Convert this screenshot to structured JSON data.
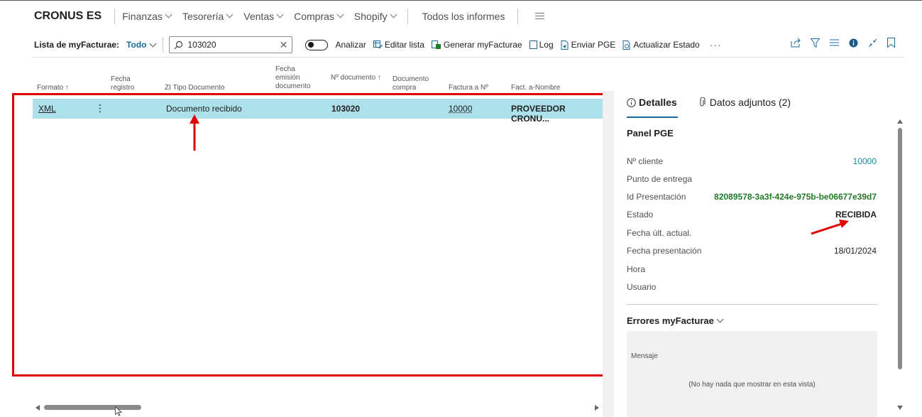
{
  "app": {
    "brand": "CRONUS ES",
    "nav": [
      {
        "label": "Finanzas"
      },
      {
        "label": "Tesorería"
      },
      {
        "label": "Ventas"
      },
      {
        "label": "Compras"
      },
      {
        "label": "Shopify"
      }
    ],
    "all_reports": "Todos los informes"
  },
  "actionbar": {
    "list_label": "Lista de myFacturae:",
    "filter_view": "Todo",
    "search_value": "103020",
    "analyze_label": "Analizar",
    "edit_list": "Editar lista",
    "generate": "Generar myFacturae",
    "log": "Log",
    "send": "Enviar PGE",
    "update_status": "Actualizar Estado",
    "more": "···"
  },
  "columns": {
    "formato": "Formato ↑",
    "fecha_registro": "Fecha registro",
    "tipo_documento": "ZI Tipo Documento",
    "fecha_emision": "Fecha emisión documento",
    "no_documento": "Nº documento ↑",
    "documento_compra": "Documento compra",
    "factura_a": "Factura a Nº",
    "fact_nombre": "Fact. a-Nombre"
  },
  "rows": [
    {
      "formato": "XML",
      "menu": "⋮",
      "tipo_documento": "Documento recibido",
      "no_documento": "103020",
      "factura_a": "10000",
      "fact_nombre": "PROVEEDOR CRONU..."
    }
  ],
  "panel": {
    "tab_details": "Detalles",
    "tab_attachments": "Datos adjuntos (2)",
    "title": "Panel PGE",
    "fields": [
      {
        "label": "Nº cliente",
        "value": "10000"
      },
      {
        "label": "Punto de entrega",
        "value": ""
      },
      {
        "label": "Id Presentación",
        "value": "82089578-3a3f-424e-975b-be06677e39d7"
      },
      {
        "label": "Estado",
        "value": "RECIBIDA"
      },
      {
        "label": "Fecha últ. actual.",
        "value": ""
      },
      {
        "label": "Fecha presentación",
        "value": "18/01/2024"
      },
      {
        "label": "Hora",
        "value": ""
      },
      {
        "label": "Usuario",
        "value": ""
      }
    ],
    "errors_title": "Errores myFacturae",
    "errors_column": "Mensaje",
    "errors_empty": "(No hay nada que mostrar en esta vista)"
  },
  "colors": {
    "accent": "#1a6a9c",
    "row_selected": "#ace0ea",
    "highlight_red": "#e00000",
    "status_green": "#217a2a"
  },
  "icons": {
    "search": "search-icon",
    "clear": "close-icon",
    "edit_list": "edit-list-icon",
    "generate": "generate-icon",
    "log": "log-icon",
    "send": "send-icon",
    "update": "update-icon",
    "share": "share-icon",
    "filter": "filter-icon",
    "list_view": "list-view-icon",
    "info": "info-icon",
    "collapse": "collapse-icon",
    "bookmark": "bookmark-icon",
    "paperclip": "paperclip-icon"
  }
}
